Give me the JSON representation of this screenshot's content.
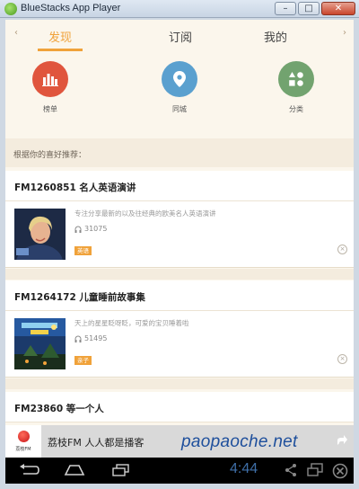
{
  "window": {
    "title": "BlueStacks App Player",
    "buttons": [
      "–",
      "□",
      "✕"
    ]
  },
  "tabs": {
    "items": [
      {
        "label": "发现",
        "active": true
      },
      {
        "label": "订阅",
        "active": false
      },
      {
        "label": "我的",
        "active": false
      }
    ],
    "left_arrow": "‹",
    "right_arrow": "›",
    "accent": "#f0a23a"
  },
  "categories": [
    {
      "label": "榜单",
      "icon": "bar-chart-icon",
      "color": "#e0553d"
    },
    {
      "label": "同城",
      "icon": "map-pin-icon",
      "color": "#5aa0cf"
    },
    {
      "label": "分类",
      "icon": "shapes-icon",
      "color": "#72a36f"
    }
  ],
  "recommend_hint": "根据你的喜好推荐：",
  "cards": [
    {
      "title": "FM1260851  名人英语演讲",
      "desc": "专注分享最新的以及往经典的欧美名人英语演讲",
      "plays": "31075",
      "tag": "英语"
    },
    {
      "title": "FM1264172  儿童睡前故事集",
      "desc": "天上的星星眨呀眨，可爱的宝贝睡着啦",
      "plays": "51495",
      "tag": "亲子"
    },
    {
      "title": "FM23860  等一个人"
    }
  ],
  "ad": {
    "logo_text": "荔枝FM",
    "text": "荔枝FM 人人都是播客",
    "watermark": "paopaoche.net"
  },
  "status": {
    "clock": "4:44"
  }
}
